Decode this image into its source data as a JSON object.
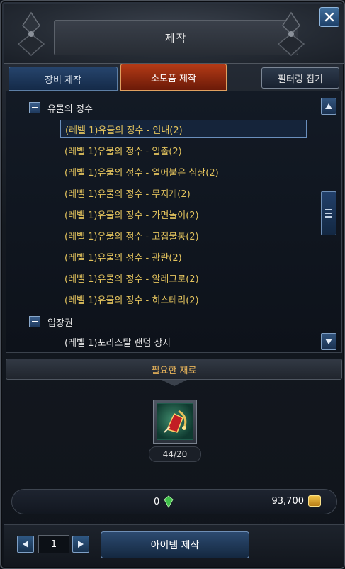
{
  "window": {
    "title": "제작"
  },
  "tabs": [
    {
      "label": "장비 제작",
      "active": false
    },
    {
      "label": "소모품 제작",
      "active": true
    }
  ],
  "filter_button": {
    "label": "필터링 접기"
  },
  "categories": [
    {
      "label": "유물의 정수",
      "expanded": true,
      "items": [
        {
          "label": "(레벨 1)유물의 정수 - 인내(2)",
          "selected": true
        },
        {
          "label": "(레벨 1)유물의 정수 - 일출(2)"
        },
        {
          "label": "(레벨 1)유물의 정수 - 얼어붙은 심장(2)"
        },
        {
          "label": "(레벨 1)유물의 정수 - 무지개(2)"
        },
        {
          "label": "(레벨 1)유물의 정수 - 가면놀이(2)"
        },
        {
          "label": "(레벨 1)유물의 정수 - 고집불통(2)"
        },
        {
          "label": "(레벨 1)유물의 정수 - 광란(2)"
        },
        {
          "label": "(레벨 1)유물의 정수 - 알레그로(2)"
        },
        {
          "label": "(레벨 1)유물의 정수 - 히스테리(2)"
        }
      ]
    },
    {
      "label": "입장권",
      "expanded": true,
      "items": [
        {
          "label": "(레벨 1)포리스탈 랜덤 상자"
        }
      ]
    }
  ],
  "materials": {
    "header": "필요한 재료",
    "items": [
      {
        "count_text": "44/20",
        "icon": "relic-material-icon"
      }
    ]
  },
  "cost": {
    "gem": "0",
    "gold": "93,700"
  },
  "footer": {
    "page": "1",
    "craft_label": "아이템 제작"
  },
  "colors": {
    "item_text": "#e3c35d",
    "header_accent": "#e8b45a",
    "active_tab": "#b33a16"
  }
}
